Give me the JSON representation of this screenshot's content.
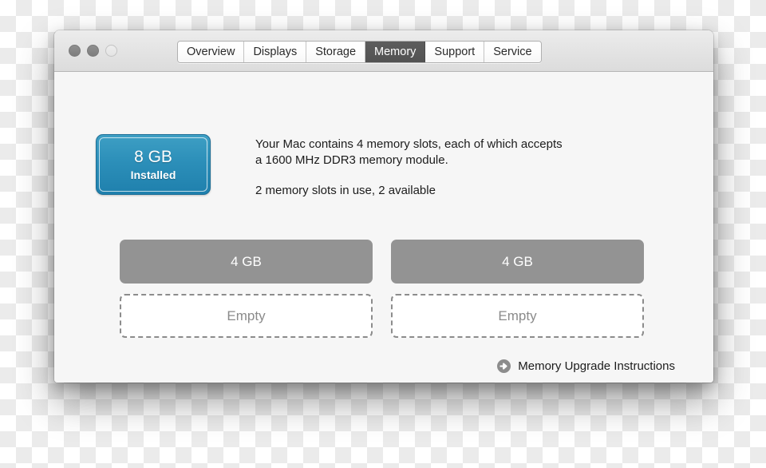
{
  "window": {
    "traffic_lights": [
      {
        "name": "close",
        "state": "inactive"
      },
      {
        "name": "minimize",
        "state": "inactive"
      },
      {
        "name": "zoom",
        "state": "inactive"
      }
    ]
  },
  "tabs": [
    {
      "label": "Overview",
      "selected": false
    },
    {
      "label": "Displays",
      "selected": false
    },
    {
      "label": "Storage",
      "selected": false
    },
    {
      "label": "Memory",
      "selected": true
    },
    {
      "label": "Support",
      "selected": false
    },
    {
      "label": "Service",
      "selected": false
    }
  ],
  "badge": {
    "size": "8 GB",
    "state": "Installed",
    "accent_color": "#2c8fb9"
  },
  "description": {
    "line1": "Your Mac contains 4 memory slots, each of which accepts",
    "line2": "a 1600 MHz DDR3 memory module.",
    "summary": "2 memory slots in use, 2 available"
  },
  "slots": [
    {
      "label": "4 GB",
      "status": "used"
    },
    {
      "label": "4 GB",
      "status": "used"
    },
    {
      "label": "Empty",
      "status": "empty"
    },
    {
      "label": "Empty",
      "status": "empty"
    }
  ],
  "footer": {
    "icon": "arrow-right-circle-icon",
    "link_label": "Memory Upgrade Instructions"
  }
}
